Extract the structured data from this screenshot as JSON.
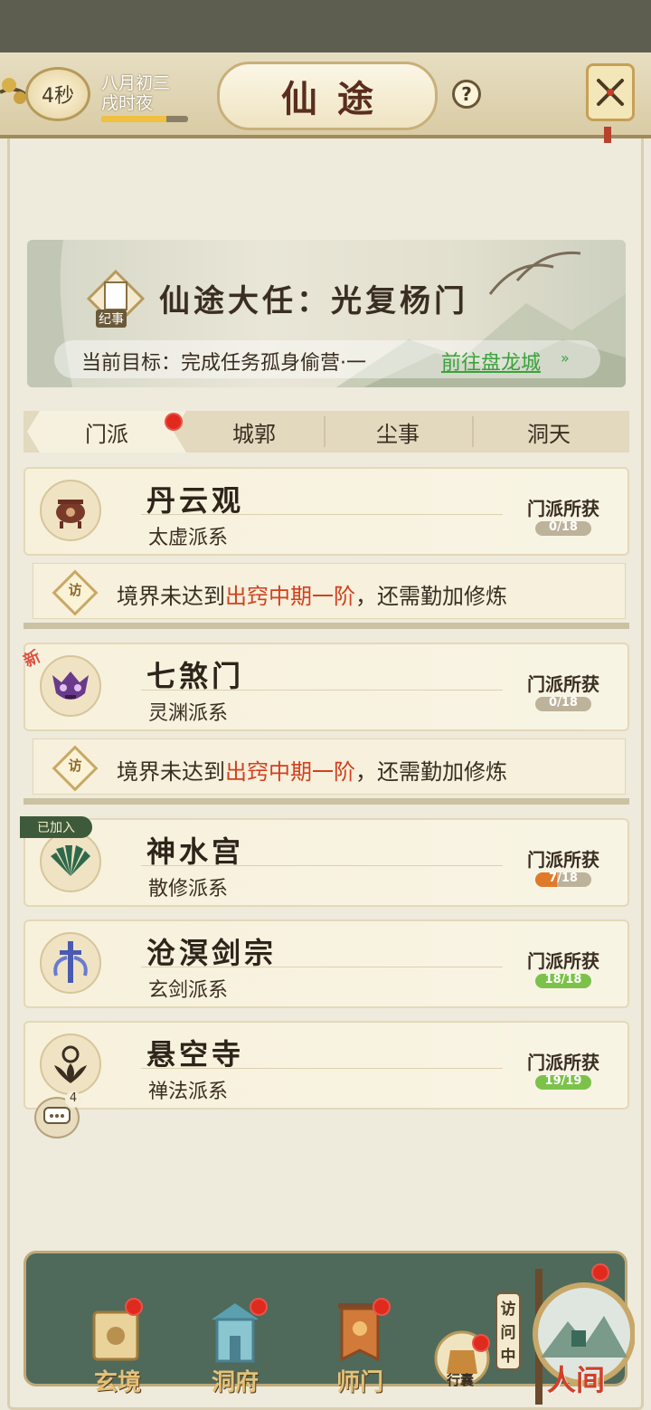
{
  "header": {
    "timer": "4秒",
    "date_line1": "八月初三",
    "date_line2": "戌时夜",
    "time_progress": 0.75,
    "title": "仙途",
    "help_label": "?"
  },
  "banner": {
    "badge": "纪事",
    "title": "仙途大任：光复杨门",
    "goal_text": "当前目标：完成任务孤身偷营·一",
    "goal_link": "前往盘龙城",
    "goal_arrow": "»"
  },
  "tabs": [
    {
      "label": "门派",
      "active": true,
      "has_dot": true
    },
    {
      "label": "城郭",
      "active": false
    },
    {
      "label": "尘事",
      "active": false
    },
    {
      "label": "洞天",
      "active": false
    }
  ],
  "sects": [
    {
      "name": "丹云观",
      "lineage": "太虚派系",
      "gain_label": "门派所获",
      "gain": "0/18",
      "gain_fraction": 0.0,
      "icon": "cauldron-icon",
      "notice": {
        "fang": "访",
        "pre": "境界未达到",
        "req": "出窍中期一阶",
        "post": "，还需勤加修炼"
      }
    },
    {
      "name": "七煞门",
      "lineage": "灵渊派系",
      "gain_label": "门派所获",
      "gain": "0/18",
      "gain_fraction": 0.0,
      "icon": "demon-mask-icon",
      "tag": "新",
      "notice": {
        "fang": "访",
        "pre": "境界未达到",
        "req": "出窍中期一阶",
        "post": "，还需勤加修炼"
      }
    },
    {
      "name": "神水宫",
      "lineage": "散修派系",
      "gain_label": "门派所获",
      "gain": "7/18",
      "gain_fraction": 0.39,
      "icon": "fan-leaf-icon",
      "tag": "已加入"
    },
    {
      "name": "沧溟剑宗",
      "lineage": "玄剑派系",
      "gain_label": "门派所获",
      "gain": "18/18",
      "gain_fraction": 1.0,
      "icon": "sword-emblem-icon"
    },
    {
      "name": "悬空寺",
      "lineage": "禅法派系",
      "gain_label": "门派所获",
      "gain": "19/19",
      "gain_fraction": 1.0,
      "icon": "lotus-icon"
    }
  ],
  "chat": {
    "count": "4"
  },
  "nav": [
    {
      "label": "玄境",
      "icon": "scroll-map-icon",
      "has_dot": true
    },
    {
      "label": "洞府",
      "icon": "pavilion-icon",
      "has_dot": true
    },
    {
      "label": "师门",
      "icon": "banner-icon",
      "has_dot": true
    },
    {
      "label": "行囊",
      "icon": "bag-icon",
      "has_dot": true
    },
    {
      "label": "人间",
      "icon": "landscape-icon",
      "has_dot": true,
      "side_tag": "访问中"
    }
  ],
  "colors": {
    "accent_red": "#d2401e",
    "link_green": "#3aa23a",
    "progress_green": "#7cc24a",
    "progress_orange": "#e07a2a",
    "dot_red": "#e12a1e",
    "nav_bg": "#4f6a5a"
  }
}
